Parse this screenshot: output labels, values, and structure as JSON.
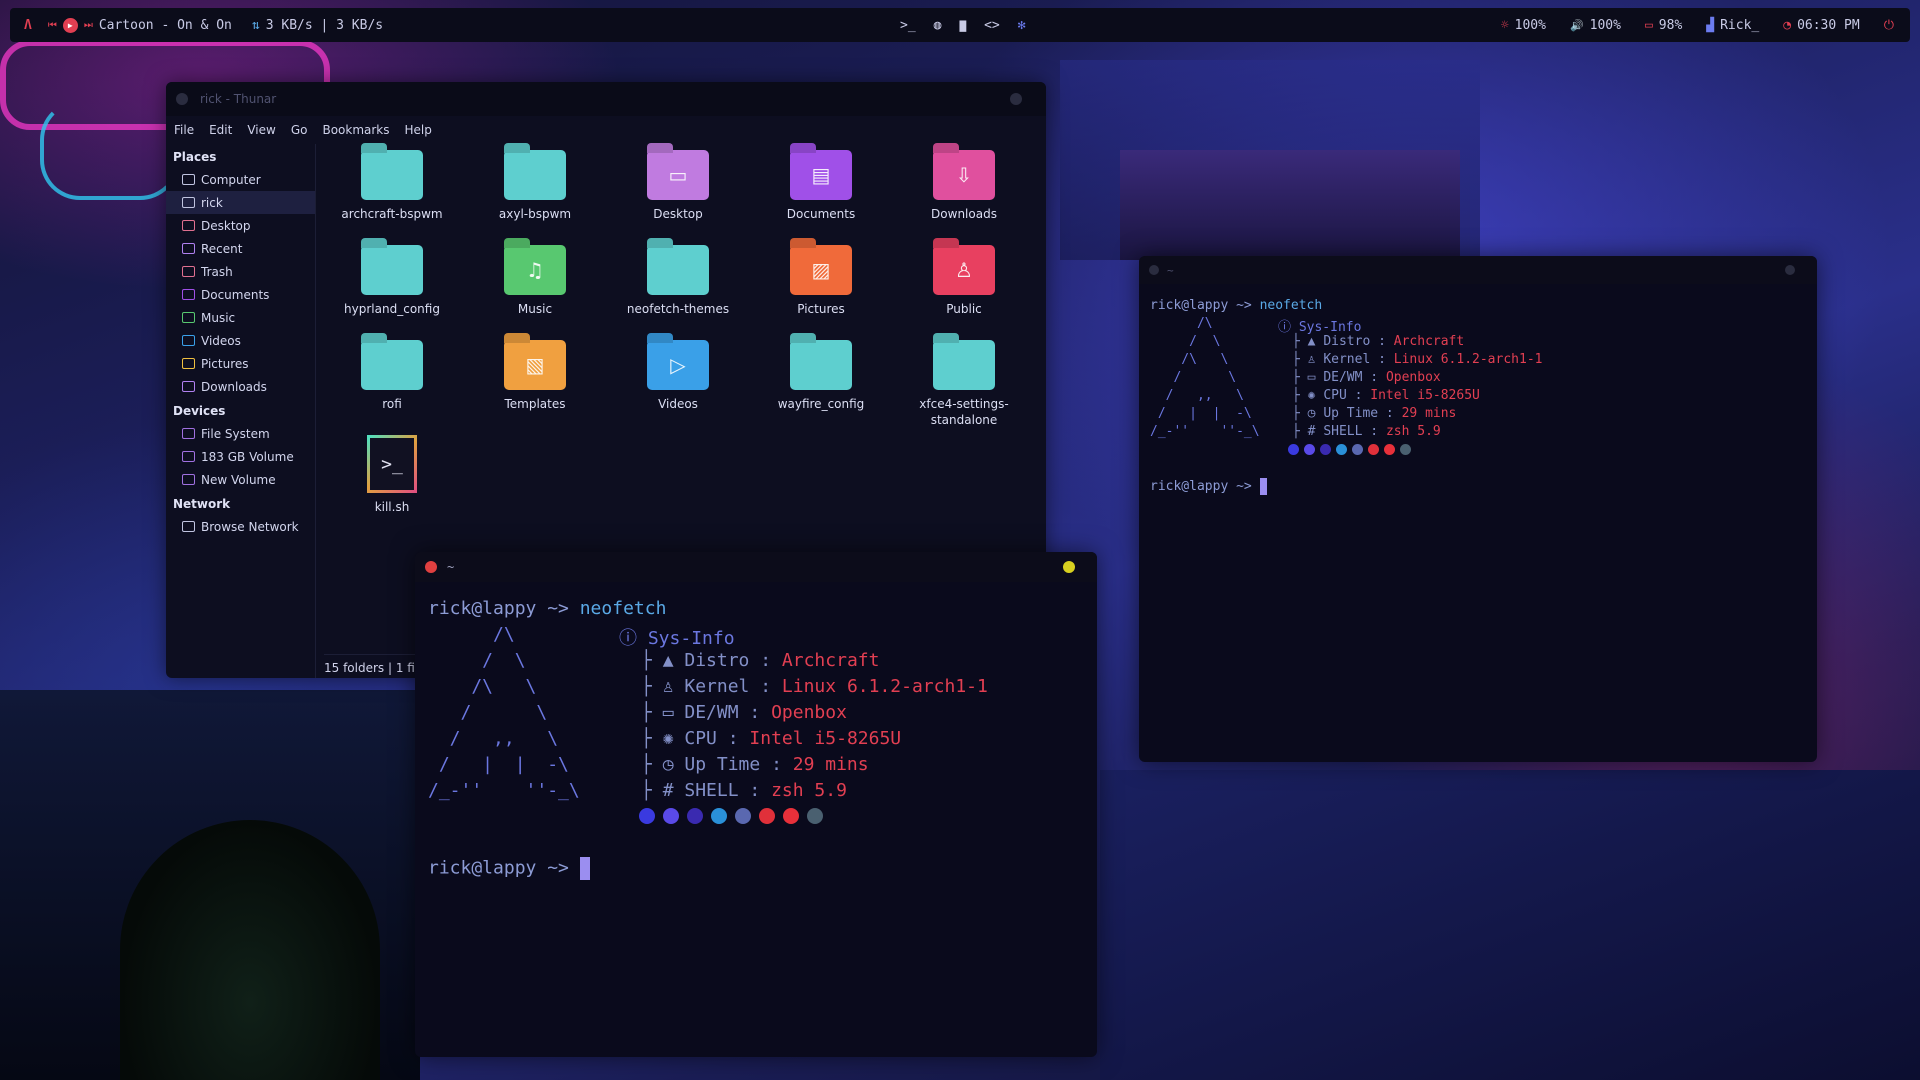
{
  "topbar": {
    "media_title": "Cartoon - On & On",
    "network": "3 KB/s | 3 KB/s",
    "brightness": "100%",
    "volume": "100%",
    "battery": "98%",
    "wifi": "Rick_",
    "time": "06:30 PM",
    "icons": {
      "logo": "archcraft-logo-icon",
      "media": [
        "previous-icon",
        "play-pause-icon",
        "next-icon"
      ],
      "apps": [
        "terminal-icon",
        "web-browser-icon",
        "file-manager-icon",
        "code-editor-icon",
        "settings-icon"
      ],
      "power": "power-icon"
    },
    "glyphs": {
      "logo": "Λ",
      "prev": "⏮",
      "play": "▶",
      "next": "⏭",
      "net": "⇅",
      "terminal": ">_",
      "browser": "◍",
      "files": "▇",
      "code": "<>",
      "settings": "✻",
      "brightness": "☼",
      "volume": "🔊",
      "battery": "▭",
      "wifi": "▟",
      "clock": "◔",
      "power": "⏻"
    }
  },
  "thunar": {
    "title": "rick - Thunar",
    "menu": [
      "File",
      "Edit",
      "View",
      "Go",
      "Bookmarks",
      "Help"
    ],
    "sidebar": {
      "places_heading": "Places",
      "places": [
        "Computer",
        "rick",
        "Desktop",
        "Recent",
        "Trash",
        "Documents",
        "Music",
        "Videos",
        "Pictures",
        "Downloads"
      ],
      "devices_heading": "Devices",
      "devices": [
        "File System",
        "183 GB Volume",
        "New Volume"
      ],
      "network_heading": "Network",
      "network": [
        "Browse Network"
      ]
    },
    "files": [
      {
        "name": "archcraft-bspwm",
        "color": "#5ecfcf",
        "glyph": ""
      },
      {
        "name": "axyl-bspwm",
        "color": "#5ecfcf",
        "glyph": ""
      },
      {
        "name": "Desktop",
        "color": "#c07be0",
        "glyph": "▭"
      },
      {
        "name": "Documents",
        "color": "#a050e8",
        "glyph": "▤"
      },
      {
        "name": "Downloads",
        "color": "#e0509e",
        "glyph": "⇩"
      },
      {
        "name": "hyprland_config",
        "color": "#5ecfcf",
        "glyph": ""
      },
      {
        "name": "Music",
        "color": "#58c870",
        "glyph": "♫"
      },
      {
        "name": "neofetch-themes",
        "color": "#5ecfcf",
        "glyph": ""
      },
      {
        "name": "Pictures",
        "color": "#f06a3a",
        "glyph": "▨"
      },
      {
        "name": "Public",
        "color": "#e84060",
        "glyph": "♙"
      },
      {
        "name": "rofi",
        "color": "#5ecfcf",
        "glyph": ""
      },
      {
        "name": "Templates",
        "color": "#f0a040",
        "glyph": "▧"
      },
      {
        "name": "Videos",
        "color": "#3aa0e8",
        "glyph": "▷"
      },
      {
        "name": "wayfire_config",
        "color": "#5ecfcf",
        "glyph": ""
      },
      {
        "name": "xfce4-settings-standalone",
        "color": "#5ecfcf",
        "glyph": ""
      },
      {
        "name": "kill.sh",
        "color": "#1a1a2e",
        "glyph": ">_"
      }
    ],
    "status": "15 folders  |  1 fi"
  },
  "terminal_main": {
    "title": "~",
    "prompt": "rick@lappy ~>",
    "command": "neofetch",
    "ascii": [
      "      /\\",
      "     /  \\",
      "    /\\   \\",
      "   /      \\",
      "  /   ,,   \\",
      " /   |  |  -\\",
      "/_-''    ''-_\\"
    ],
    "sysinfo_title": "Sys-Info",
    "info": [
      {
        "label": "Distro",
        "value": "Archcraft",
        "icon": "▲"
      },
      {
        "label": "Kernel",
        "value": "Linux 6.1.2-arch1-1",
        "icon": "♙"
      },
      {
        "label": "DE/WM",
        "value": "Openbox",
        "icon": "▭"
      },
      {
        "label": "CPU",
        "value": "Intel i5-8265U",
        "icon": "✺"
      },
      {
        "label": "Up Time",
        "value": "29 mins",
        "icon": "◷"
      },
      {
        "label": "SHELL",
        "value": "zsh 5.9",
        "icon": "#"
      }
    ],
    "colors": [
      "#3a3ae0",
      "#5a4ae8",
      "#3a2ab0",
      "#2a90d8",
      "#5a68b0",
      "#e0303a",
      "#e8303a",
      "#4a6070"
    ],
    "tree_chars": "├"
  },
  "terminal_small": {
    "title": "~",
    "prompt": "rick@lappy ~>",
    "command": "neofetch"
  }
}
